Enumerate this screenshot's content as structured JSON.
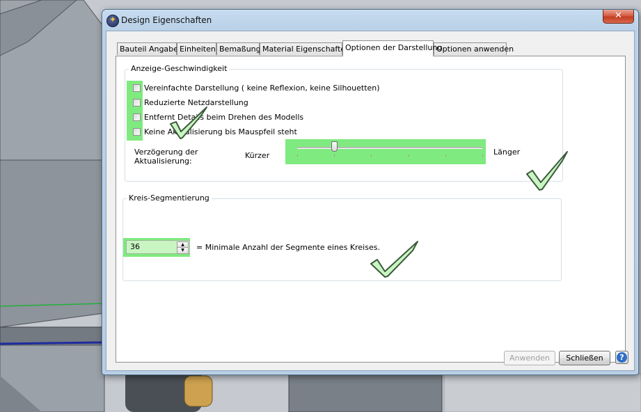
{
  "window": {
    "title": "Design Eigenschaften",
    "close_label": "✕"
  },
  "tabs": [
    {
      "label": "Bauteil Angaben",
      "active": false
    },
    {
      "label": "Einheiten",
      "active": false
    },
    {
      "label": "Bemaßung",
      "active": false
    },
    {
      "label": "Material Eigenschaften",
      "active": false
    },
    {
      "label": "Optionen der Darstellung",
      "active": true
    },
    {
      "label": "Optionen anwenden",
      "active": false
    }
  ],
  "speed_group": {
    "title": "Anzeige-Geschwindigkeit",
    "options": [
      {
        "label": "Vereinfachte Darstellung ( keine Reflexion, keine Silhouetten)",
        "checked": false
      },
      {
        "label": "Reduzierte Netzdarstellung",
        "checked": false
      },
      {
        "label": "Entfernt Details beim Drehen des Modells",
        "checked": false
      },
      {
        "label": "Keine Aktualisierung bis Mauspfeil steht",
        "checked": false
      }
    ],
    "delay_label": "Verzögerung der Aktualisierung:",
    "slider_min_label": "Kürzer",
    "slider_max_label": "Länger",
    "slider_value": 0.2
  },
  "segment_group": {
    "title": "Kreis-Segmentierung",
    "value": "36",
    "description": "= Minimale Anzahl der Segmente eines Kreises."
  },
  "buttons": {
    "apply": "Anwenden",
    "close": "Schließen",
    "help": "?"
  },
  "colors": {
    "highlight": "#7fea7f",
    "check_fill": "#c9f5c2",
    "check_stroke": "#3c5a3c",
    "help": "#2f6ec8"
  },
  "icons": {
    "app": "star-app-icon",
    "check": "check-mark-icon",
    "help": "help-icon"
  }
}
